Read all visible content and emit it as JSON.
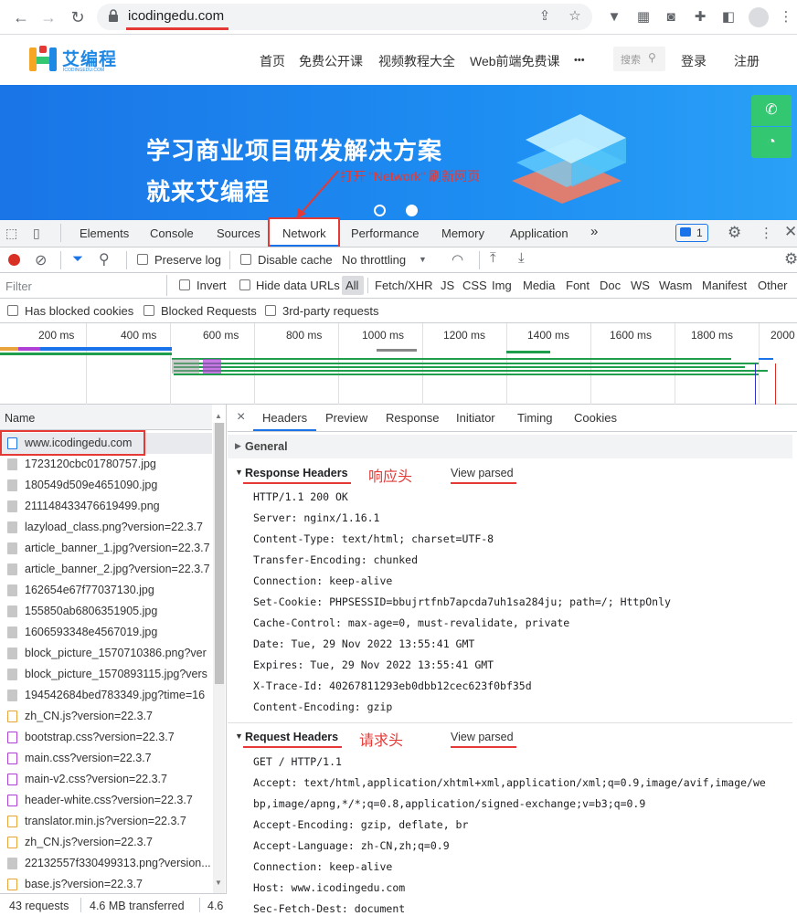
{
  "browser": {
    "url": "icodingedu.com"
  },
  "site": {
    "logo_text": "艾编程",
    "logo_sub": "ICODINGEDU.COM",
    "nav": [
      "首页",
      "免费公开课",
      "视频教程大全",
      "Web前端免费课"
    ],
    "nav_more": "•••",
    "search_placeholder": "搜索",
    "login": "登录",
    "register": "注册",
    "banner_line1": "学习商业项目研发解决方案",
    "banner_line2": "就来艾编程",
    "annotation": "打开 \"Network\" 刷新网页"
  },
  "devtools": {
    "tabs": [
      "Elements",
      "Console",
      "Sources",
      "Network",
      "Performance",
      "Memory",
      "Application"
    ],
    "more_tabs": "»",
    "message_count": "1",
    "toolbar": {
      "preserve_log": "Preserve log",
      "disable_cache": "Disable cache",
      "throttling": "No throttling"
    },
    "filter": {
      "placeholder": "Filter",
      "invert": "Invert",
      "hide_data_urls": "Hide data URLs",
      "types": [
        "All",
        "Fetch/XHR",
        "JS",
        "CSS",
        "Img",
        "Media",
        "Font",
        "Doc",
        "WS",
        "Wasm",
        "Manifest",
        "Other"
      ],
      "has_blocked_cookies": "Has blocked cookies",
      "blocked_requests": "Blocked Requests",
      "third_party": "3rd-party requests"
    },
    "timeline_ticks": [
      "200 ms",
      "400 ms",
      "600 ms",
      "800 ms",
      "1000 ms",
      "1200 ms",
      "1400 ms",
      "1600 ms",
      "1800 ms",
      "2000"
    ],
    "request_list": {
      "header": "Name",
      "rows": [
        {
          "name": "www.icodingedu.com",
          "icon": "doc-icon"
        },
        {
          "name": "1723120cbc01780757.jpg",
          "icon": "img-icon"
        },
        {
          "name": "180549d509e4651090.jpg",
          "icon": "img-icon"
        },
        {
          "name": "211148433476619499.png",
          "icon": "img-icon"
        },
        {
          "name": "lazyload_class.png?version=22.3.7",
          "icon": "img-icon"
        },
        {
          "name": "article_banner_1.jpg?version=22.3.7",
          "icon": "img-icon"
        },
        {
          "name": "article_banner_2.jpg?version=22.3.7",
          "icon": "img-icon"
        },
        {
          "name": "162654e67f77037130.jpg",
          "icon": "img-icon"
        },
        {
          "name": "155850ab6806351905.jpg",
          "icon": "img-icon"
        },
        {
          "name": "1606593348e4567019.jpg",
          "icon": "img-icon"
        },
        {
          "name": "block_picture_1570710386.png?ver",
          "icon": "img-icon"
        },
        {
          "name": "block_picture_1570893115.jpg?vers",
          "icon": "img-icon"
        },
        {
          "name": "194542684bed783349.jpg?time=16",
          "icon": "img-icon"
        },
        {
          "name": "zh_CN.js?version=22.3.7",
          "icon": "js-icon"
        },
        {
          "name": "bootstrap.css?version=22.3.7",
          "icon": "css-icon"
        },
        {
          "name": "main.css?version=22.3.7",
          "icon": "css-icon"
        },
        {
          "name": "main-v2.css?version=22.3.7",
          "icon": "css-icon"
        },
        {
          "name": "header-white.css?version=22.3.7",
          "icon": "css-icon"
        },
        {
          "name": "translator.min.js?version=22.3.7",
          "icon": "js-icon"
        },
        {
          "name": "zh_CN.js?version=22.3.7",
          "icon": "js-icon"
        },
        {
          "name": "22132557f330499313.png?version...",
          "icon": "img-icon"
        },
        {
          "name": "base.js?version=22.3.7",
          "icon": "js-icon"
        }
      ],
      "status_requests": "43 requests",
      "status_transferred": "4.6 MB transferred",
      "status_extra": "4.6"
    },
    "detail": {
      "close": "×",
      "tabs": [
        "Headers",
        "Preview",
        "Response",
        "Initiator",
        "Timing",
        "Cookies"
      ],
      "general": "General",
      "response_headers_title": "Response Headers",
      "response_annotation": "响应头",
      "view_parsed": "View parsed",
      "response_headers": [
        "HTTP/1.1 200 OK",
        "Server: nginx/1.16.1",
        "Content-Type: text/html; charset=UTF-8",
        "Transfer-Encoding: chunked",
        "Connection: keep-alive",
        "Set-Cookie: PHPSESSID=bbujrtfnb7apcda7uh1sa284ju; path=/; HttpOnly",
        "Cache-Control: max-age=0, must-revalidate, private",
        "Date: Tue, 29 Nov 2022 13:55:41 GMT",
        "Expires: Tue, 29 Nov 2022 13:55:41 GMT",
        "X-Trace-Id: 40267811293eb0dbb12cec623f0bf35d",
        "Content-Encoding: gzip"
      ],
      "request_headers_title": "Request Headers",
      "request_annotation": "请求头",
      "request_headers": [
        "GET / HTTP/1.1",
        "Accept: text/html,application/xhtml+xml,application/xml;q=0.9,image/avif,image/we",
        "bp,image/apng,*/*;q=0.8,application/signed-exchange;v=b3;q=0.9",
        "Accept-Encoding: gzip, deflate, br",
        "Accept-Language: zh-CN,zh;q=0.9",
        "Connection: keep-alive",
        "Host: www.icodingedu.com",
        "Sec-Fetch-Dest: document"
      ]
    }
  }
}
